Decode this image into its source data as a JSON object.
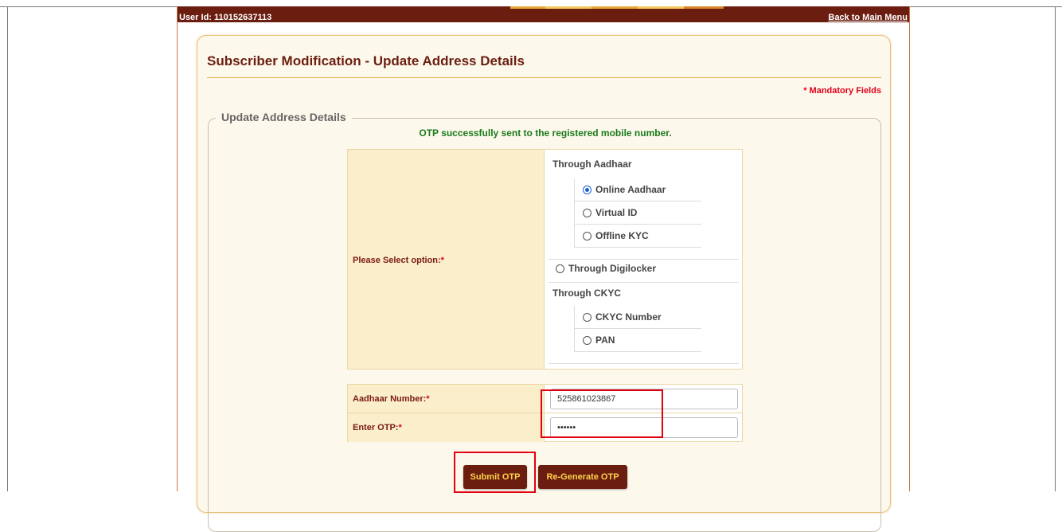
{
  "header": {
    "user_id": "User Id: 110152637113",
    "back_link": "Back to Main Menu"
  },
  "page": {
    "title": "Subscriber Modification - Update Address Details",
    "mandatory_note": "* Mandatory Fields"
  },
  "section": {
    "legend": "Update Address Details",
    "otp_message": "OTP successfully sent to the registered mobile number."
  },
  "options": {
    "label": "Please Select option:",
    "required_mark": "*",
    "group_aadhaar": "Through Aadhaar",
    "aadhaar_items": [
      {
        "label": "Online Aadhaar",
        "selected": true
      },
      {
        "label": "Virtual ID",
        "selected": false
      },
      {
        "label": "Offline KYC",
        "selected": false
      }
    ],
    "digilocker": "Through Digilocker",
    "group_ckyc": "Through CKYC",
    "ckyc_items": [
      {
        "label": "CKYC Number",
        "selected": false
      },
      {
        "label": "PAN",
        "selected": false
      }
    ]
  },
  "form": {
    "aadhaar_label": "Aadhaar Number:",
    "aadhaar_value": "525861023867",
    "otp_label": "Enter OTP:",
    "otp_value": "••••••",
    "required_mark": "*"
  },
  "buttons": {
    "submit": "Submit OTP",
    "regenerate": "Re-Generate OTP"
  },
  "colors": {
    "brand_dark": "#6b1e10",
    "button_text": "#ffd24a",
    "success": "#1a7a1a",
    "required": "#e0001a",
    "highlight": "#e00010"
  }
}
